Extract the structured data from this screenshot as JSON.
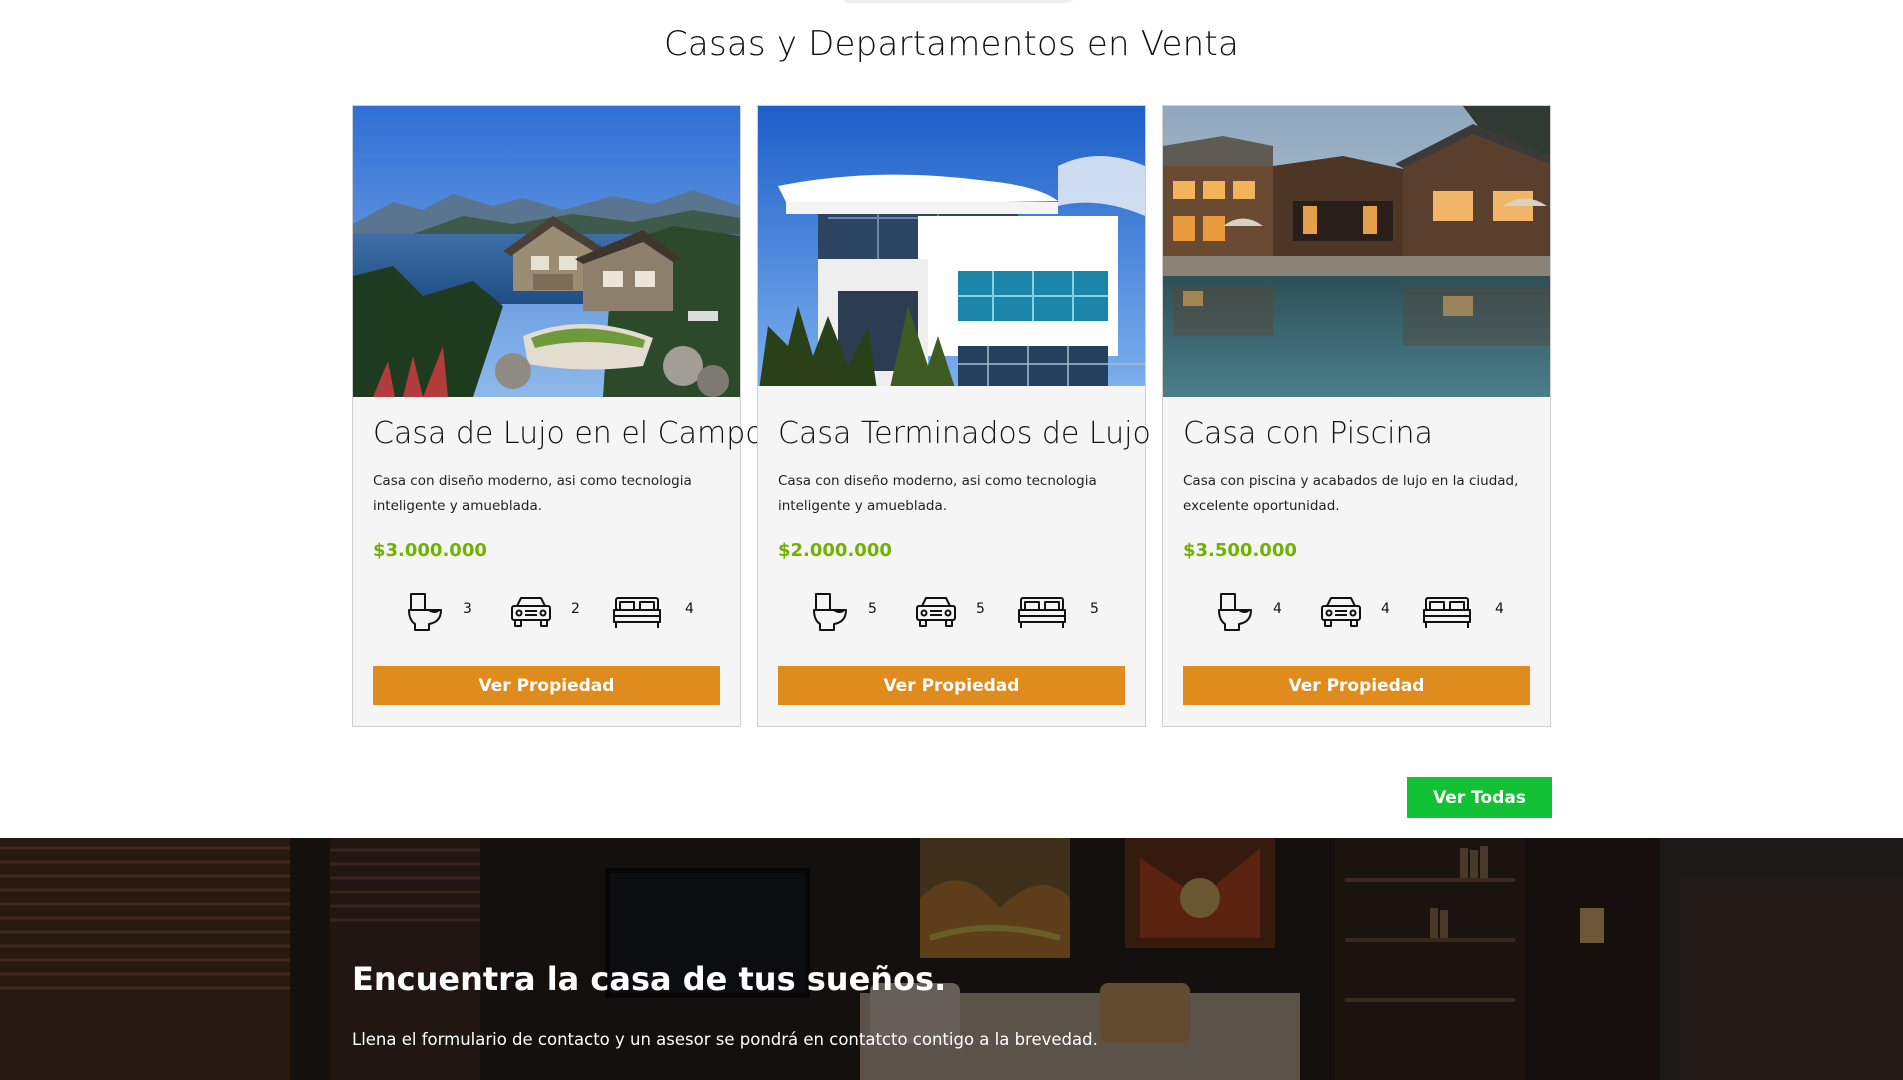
{
  "section": {
    "title": "Casas y Departamentos en Venta"
  },
  "properties": [
    {
      "title": "Casa de Lujo en el Campo",
      "description": "Casa con diseño moderno, asi como tecnologia inteligente y amueblada.",
      "price": "$3.000.000",
      "bathrooms": "3",
      "parking": "2",
      "bedrooms": "4",
      "button": "Ver Propiedad"
    },
    {
      "title": "Casa Terminados de Lujo",
      "description": "Casa con diseño moderno, asi como tecnologia inteligente y amueblada.",
      "price": "$2.000.000",
      "bathrooms": "5",
      "parking": "5",
      "bedrooms": "5",
      "button": "Ver Propiedad"
    },
    {
      "title": "Casa con Piscina",
      "description": "Casa con piscina y acabados de lujo en la ciudad, excelente oportunidad.",
      "price": "$3.500.000",
      "bathrooms": "4",
      "parking": "4",
      "bedrooms": "4",
      "button": "Ver Propiedad"
    }
  ],
  "see_all": {
    "label": "Ver Todas"
  },
  "contact_banner": {
    "title": "Encuentra la casa de tus sueños.",
    "text": "Llena el formulario de contacto y un asesor se pondrá en contatcto contigo a la brevedad."
  },
  "colors": {
    "price": "#71b100",
    "property_button": "#e08b1d",
    "see_all_button": "#13c234"
  },
  "icons": [
    "toilet-icon",
    "car-icon",
    "bed-icon"
  ]
}
